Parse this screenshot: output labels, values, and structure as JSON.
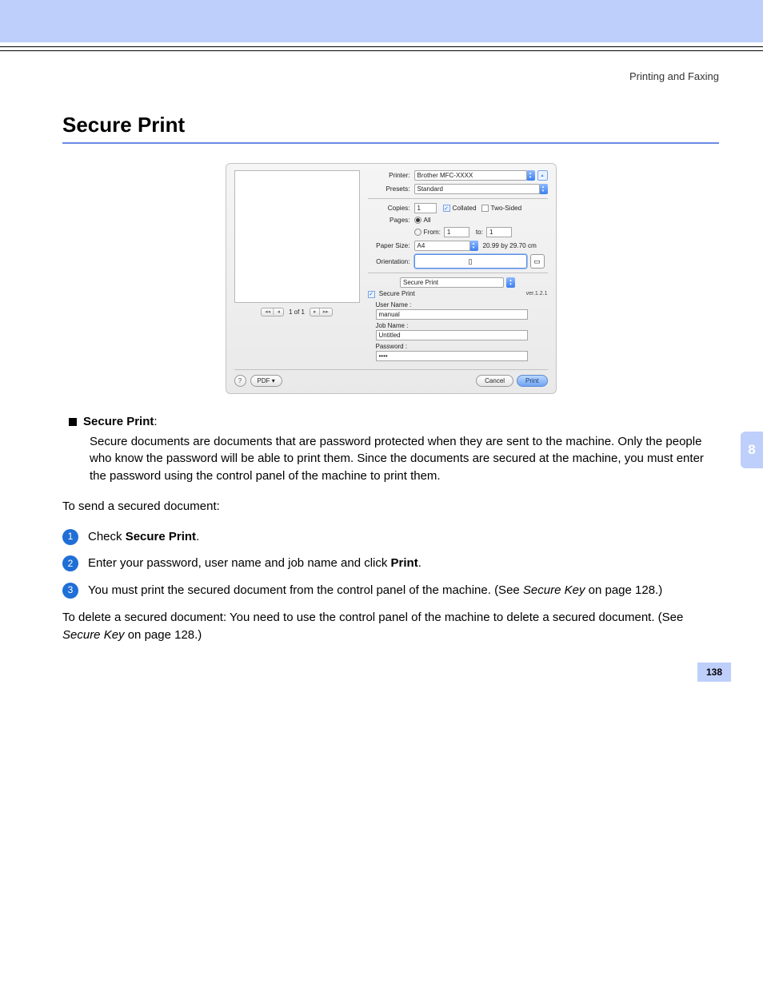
{
  "header": {
    "crumb": "Printing and Faxing"
  },
  "title": "Secure Print",
  "dialog": {
    "printer_lbl": "Printer:",
    "printer_val": "Brother MFC-XXXX",
    "presets_lbl": "Presets:",
    "presets_val": "Standard",
    "copies_lbl": "Copies:",
    "copies_val": "1",
    "collated_lbl": "Collated",
    "twosided_lbl": "Two-Sided",
    "pages_lbl": "Pages:",
    "pages_all": "All",
    "pages_from_lbl": "From:",
    "pages_from": "1",
    "pages_to_lbl": "to:",
    "pages_to": "1",
    "papersize_lbl": "Paper Size:",
    "papersize_val": "A4",
    "papersize_dim": "20.99 by 29.70 cm",
    "orientation_lbl": "Orientation:",
    "panel_name": "Secure Print",
    "version": "ver.1.2.1",
    "secure_cb": "Secure Print",
    "username_lbl": "User Name :",
    "username_val": "manual",
    "jobname_lbl": "Job Name :",
    "jobname_val": "Untitled",
    "password_lbl": "Password :",
    "password_val": "••••",
    "nav_count": "1 of 1",
    "help": "?",
    "pdf": "PDF ▾",
    "cancel": "Cancel",
    "print": "Print"
  },
  "body": {
    "bullet_title": "Secure Print",
    "bullet_text": "Secure documents are documents that are password protected when they are sent to the machine. Only the people who know the password will be able to print them. Since the documents are secured at the machine, you must enter the password using the control panel of the machine to print them.",
    "send_intro": "To send a secured document:",
    "step1_a": "Check ",
    "step1_b": "Secure Print",
    "step1_c": ".",
    "step2_a": "Enter your password, user name and job name and click ",
    "step2_b": "Print",
    "step2_c": ".",
    "step3_a": "You must print the secured document from the control panel of the machine. (See ",
    "step3_b": "Secure Key",
    "step3_c": " on page 128.)",
    "delete": "To delete a secured document: You need to use the control panel of the machine to delete a secured document. (See ",
    "delete_i": "Secure Key",
    "delete_c": " on page 128.)"
  },
  "chapter_tab": "8",
  "page_number": "138"
}
